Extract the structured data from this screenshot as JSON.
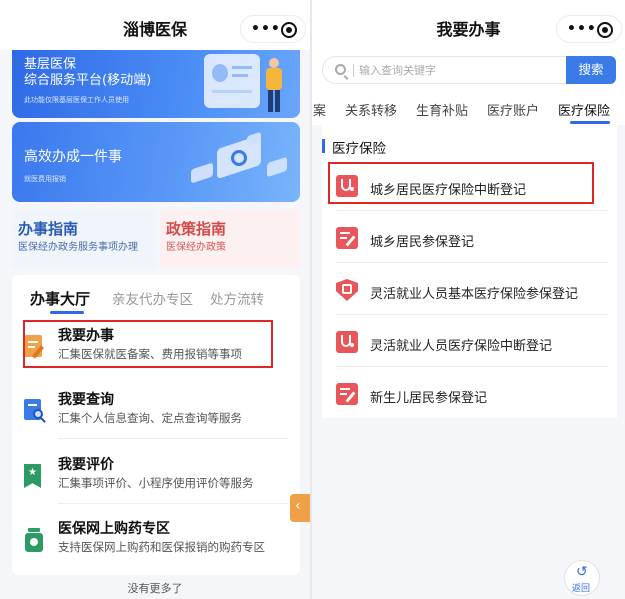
{
  "left": {
    "title": "淄博医保",
    "banner1": {
      "title_line1": "基层医保",
      "title_line2": "综合服务平台(移动端)",
      "subtitle": "此功能仅限基层医保工作人员使用"
    },
    "banner2": {
      "title": "高效办成一件事",
      "subtitle": "就医费用报销"
    },
    "guides": [
      {
        "title": "办事指南",
        "subtitle": "医保经办政务服务事项办理"
      },
      {
        "title": "政策指南",
        "subtitle": "医保经办政策"
      }
    ],
    "hall_tabs": [
      "办事大厅",
      "亲友代办专区",
      "处方流转"
    ],
    "services": [
      {
        "title": "我要办事",
        "desc": "汇集医保就医备案、费用报销等事项",
        "icon": "edit-doc-icon"
      },
      {
        "title": "我要查询",
        "desc": "汇集个人信息查询、定点查询等服务",
        "icon": "search-doc-icon"
      },
      {
        "title": "我要评价",
        "desc": "汇集事项评价、小程序使用评价等服务",
        "icon": "star-bookmark-icon"
      },
      {
        "title": "医保网上购药专区",
        "desc": "支持医保网上购药和医保报销的购药专区",
        "icon": "medicine-bottle-icon"
      }
    ],
    "no_more": "没有更多了",
    "side_tab_glyph": "‹"
  },
  "right": {
    "title": "我要办事",
    "search": {
      "placeholder": "输入查询关键字",
      "button": "搜索"
    },
    "category_tabs": [
      "案",
      "关系转移",
      "生育补贴",
      "医疗账户",
      "医疗保险"
    ],
    "active_category": "医疗保险",
    "section_title": "医疗保险",
    "items": [
      {
        "label": "城乡居民医疗保险中断登记",
        "icon": "stethoscope-icon"
      },
      {
        "label": "城乡居民参保登记",
        "icon": "edit-doc-icon"
      },
      {
        "label": "灵活就业人员基本医疗保险参保登记",
        "icon": "shield-icon"
      },
      {
        "label": "灵活就业人员医疗保险中断登记",
        "icon": "stethoscope-icon"
      },
      {
        "label": "新生儿居民参保登记",
        "icon": "edit-doc-icon"
      }
    ],
    "back": {
      "glyph": "↺",
      "label": "返回"
    }
  },
  "capsule_dots": "•••",
  "colors": {
    "brand_blue": "#2f6ae6",
    "highlight_red": "#e02727",
    "icon_red": "#e8555a",
    "icon_green": "#2c9c64",
    "orange": "#f0a046"
  }
}
